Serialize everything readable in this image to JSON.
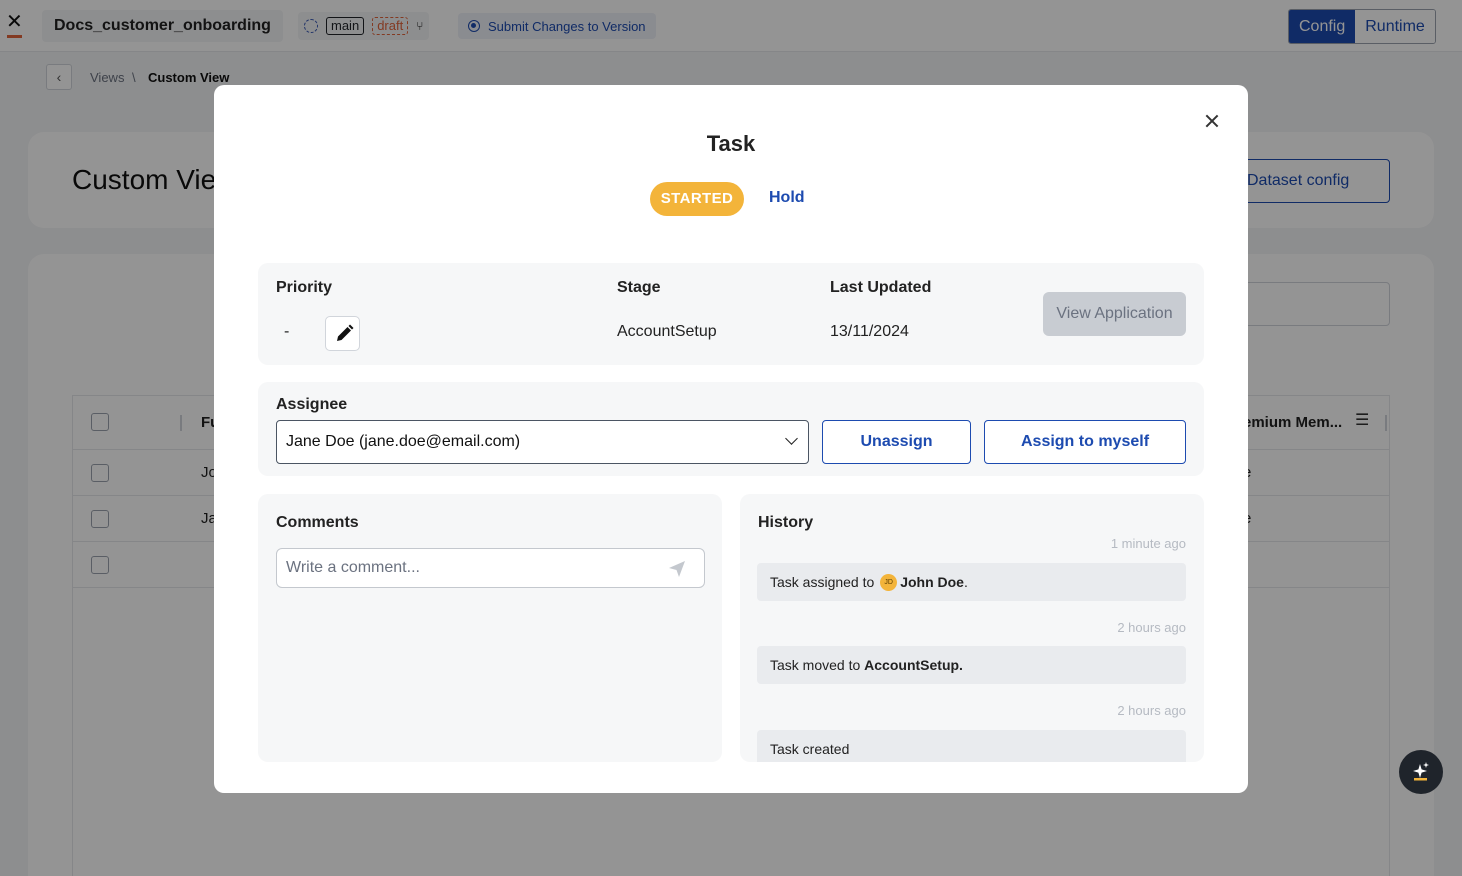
{
  "topbar": {
    "app_name": "Docs_customer_onboarding",
    "branch_tag": "main",
    "draft_tag": "draft",
    "submit_label": "Submit Changes to Version",
    "mode_config": "Config",
    "mode_runtime": "Runtime"
  },
  "breadcrumb": {
    "views": "Views",
    "separator": "\\",
    "current": "Custom View"
  },
  "page": {
    "title": "Custom View",
    "dataset_config": "Dataset config",
    "table": {
      "col_first": "Fu",
      "col_last": "emium Mem...",
      "rows": [
        {
          "first": "Jo",
          "last": "e"
        },
        {
          "first": "Ja",
          "last": "e"
        },
        {
          "first": "",
          "last": ""
        }
      ]
    }
  },
  "modal": {
    "title": "Task",
    "status": "STARTED",
    "hold_label": "Hold",
    "info": {
      "priority_label": "Priority",
      "priority_value": "-",
      "stage_label": "Stage",
      "stage_value": "AccountSetup",
      "updated_label": "Last Updated",
      "updated_value": "13/11/2024",
      "view_application": "View Application"
    },
    "assignee": {
      "label": "Assignee",
      "selected": "Jane Doe (jane.doe@email.com)",
      "unassign": "Unassign",
      "assign_myself": "Assign to myself"
    },
    "comments": {
      "label": "Comments",
      "placeholder": "Write a comment..."
    },
    "history": {
      "label": "History",
      "items": [
        {
          "time": "1 minute ago",
          "prefix": "Task assigned to",
          "avatar": "JD",
          "bold": "John Doe",
          "suffix": "."
        },
        {
          "time": "2 hours ago",
          "prefix": "Task moved to",
          "avatar": "",
          "bold": "AccountSetup.",
          "suffix": ""
        },
        {
          "time": "2 hours ago",
          "prefix": "Task created",
          "avatar": "",
          "bold": "",
          "suffix": ""
        }
      ]
    }
  },
  "colors": {
    "primary": "#1d4bb0",
    "status_started": "#f3b43a",
    "accent_orange": "#e2643b"
  }
}
